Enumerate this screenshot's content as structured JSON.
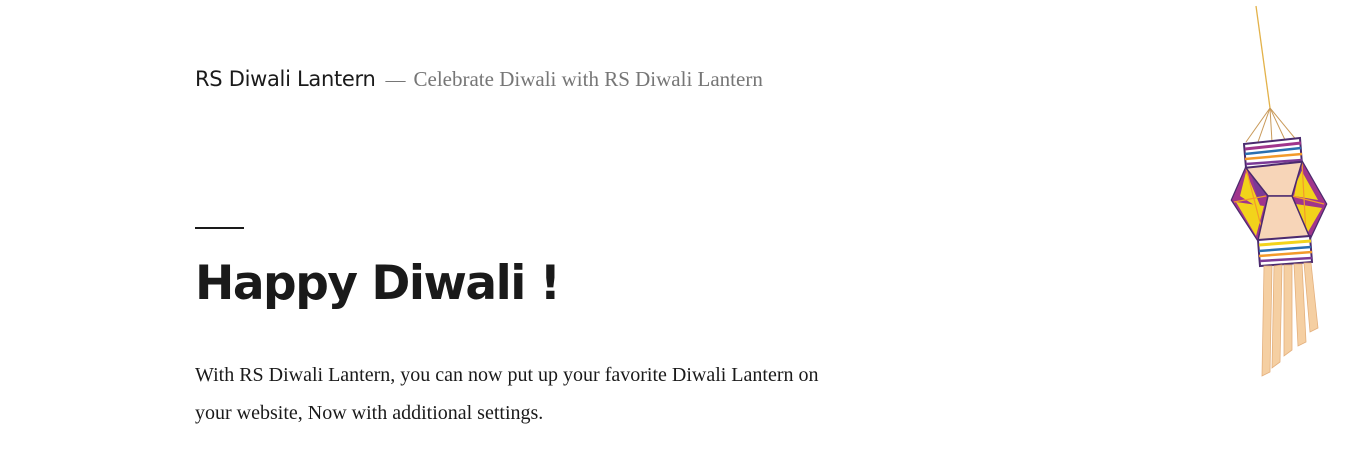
{
  "header": {
    "site_title": "RS Diwali Lantern",
    "separator": "—",
    "tagline": "Celebrate Diwali with RS Diwali Lantern"
  },
  "post": {
    "title": "Happy Diwali !",
    "content": "With RS Diwali Lantern, you can now put up your favorite Diwali Lantern on your website, Now with additional settings."
  },
  "lantern": {
    "icon": "diwali-lantern-icon",
    "colors": {
      "purple": "#7b3a96",
      "magenta": "#a0358c",
      "yellow": "#f2d31b",
      "peach": "#f7d5b8",
      "orange": "#f39a2b",
      "blue": "#2a6fb0",
      "tassel": "#f5cfa2",
      "string": "#e3b24a"
    }
  }
}
